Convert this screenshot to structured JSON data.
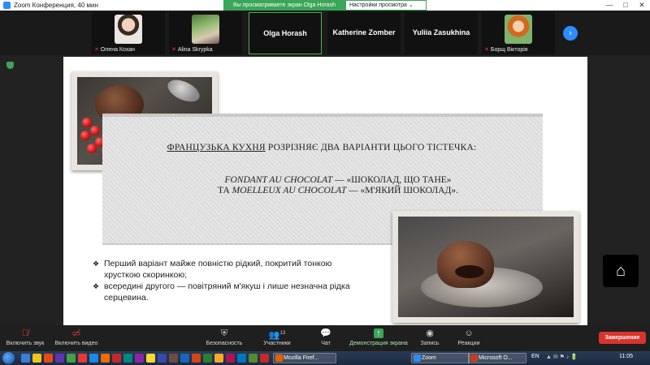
{
  "window": {
    "title": "Zoom Конференция, 40 мин",
    "controls": [
      "—",
      "□",
      "✕"
    ]
  },
  "banner": {
    "sharing_text": "Вы просматриваете экран Olga Horash",
    "view_options": "Настройки просмотра ⌄"
  },
  "participants": [
    {
      "name": "Олена Кохан",
      "muted": true,
      "has_photo": true
    },
    {
      "name": "Alina Skrypka",
      "muted": true,
      "has_photo": true
    },
    {
      "name": "Olga Horash",
      "muted": false,
      "has_photo": false,
      "active": true
    },
    {
      "name": "Katherine Zomber",
      "muted": true,
      "has_photo": false
    },
    {
      "name": "Yuliia Zasukhina",
      "muted": true,
      "has_photo": false
    },
    {
      "name": "Борщ Вікторія",
      "muted": true,
      "has_photo": true
    }
  ],
  "next_arrow": "›",
  "slide": {
    "cuisine": "ФРАНЦУЗЬКА КУХНЯ",
    "intro_rest": " РОЗРІЗНЯЄ ДВА ВАРІАНТИ ЦЬОГО ТІСТЕЧКА:",
    "fondant_name": "FONDANT AU CHOCOLAT",
    "fondant_desc": " — «ШОКОЛАД, ЩО ТАНЕ»",
    "and_word": "ТА ",
    "moelleux_name": "MOELLEUX AU CHOCOLAT",
    "moelleux_desc": " — «М'ЯКИЙ ШОКОЛАД».",
    "bullets": [
      "Перший варіант майже повністю рідкий, покритий тонкою хрусткою скоринкою;",
      "всередині другого — повітряний м'якуш і лише незначна рідка серцевина."
    ],
    "bullet_mark": "❖"
  },
  "home_glyph": "⌂",
  "toolbar": {
    "unmute_label": "Включить звук",
    "video_label": "Включить видео",
    "security_label": "Безопасность",
    "participants_label": "Участники",
    "participants_count": "13",
    "chat_label": "Чат",
    "share_label": "Демонстрация экрана",
    "record_label": "Запись",
    "reactions_label": "Реакции",
    "end_label": "Завершение"
  },
  "taskbar": {
    "tasks": [
      {
        "label": "Mozilla Firef...",
        "color": "#e66000"
      },
      {
        "label": "Zoom",
        "color": "#2d8cff"
      },
      {
        "label": "Microsoft O...",
        "color": "#c43e1c"
      }
    ],
    "lang": "EN",
    "time": "11:05"
  },
  "colors": {
    "accent_green": "#3aa657",
    "zoom_blue": "#2d8cff",
    "end_red": "#d9342b"
  }
}
